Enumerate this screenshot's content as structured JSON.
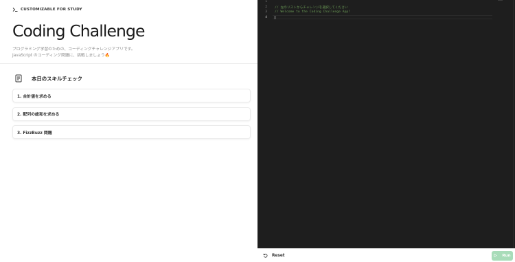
{
  "hero": {
    "badge": "CUSTOMIZABLE FOR STUDY",
    "title": "Coding Challenge",
    "desc_line1": "プログラミング学習のための、コーディングチャレンジアプリです。",
    "desc_line2": "JavaScript のコーディング問題に、挑戦しましょう🔥"
  },
  "section": {
    "title": "本日のスキルチェック",
    "challenges": [
      {
        "label": "1. 合計値を求める"
      },
      {
        "label": "2. 配列の総和を求める"
      },
      {
        "label": "3. FizzBuzz 問題"
      }
    ]
  },
  "editor": {
    "line_numbers": [
      "1",
      "2",
      "3",
      "4"
    ],
    "lines": [
      "",
      "// 左のリストからチャレンジを選択してください",
      "// Welcome to the Coding Challenge App!",
      ""
    ],
    "comment_color": "#6a9955",
    "background": "#1e1e1e"
  },
  "footer": {
    "reset_label": "Reset",
    "run_label": "Run",
    "run_color": "#a8dcb9"
  }
}
